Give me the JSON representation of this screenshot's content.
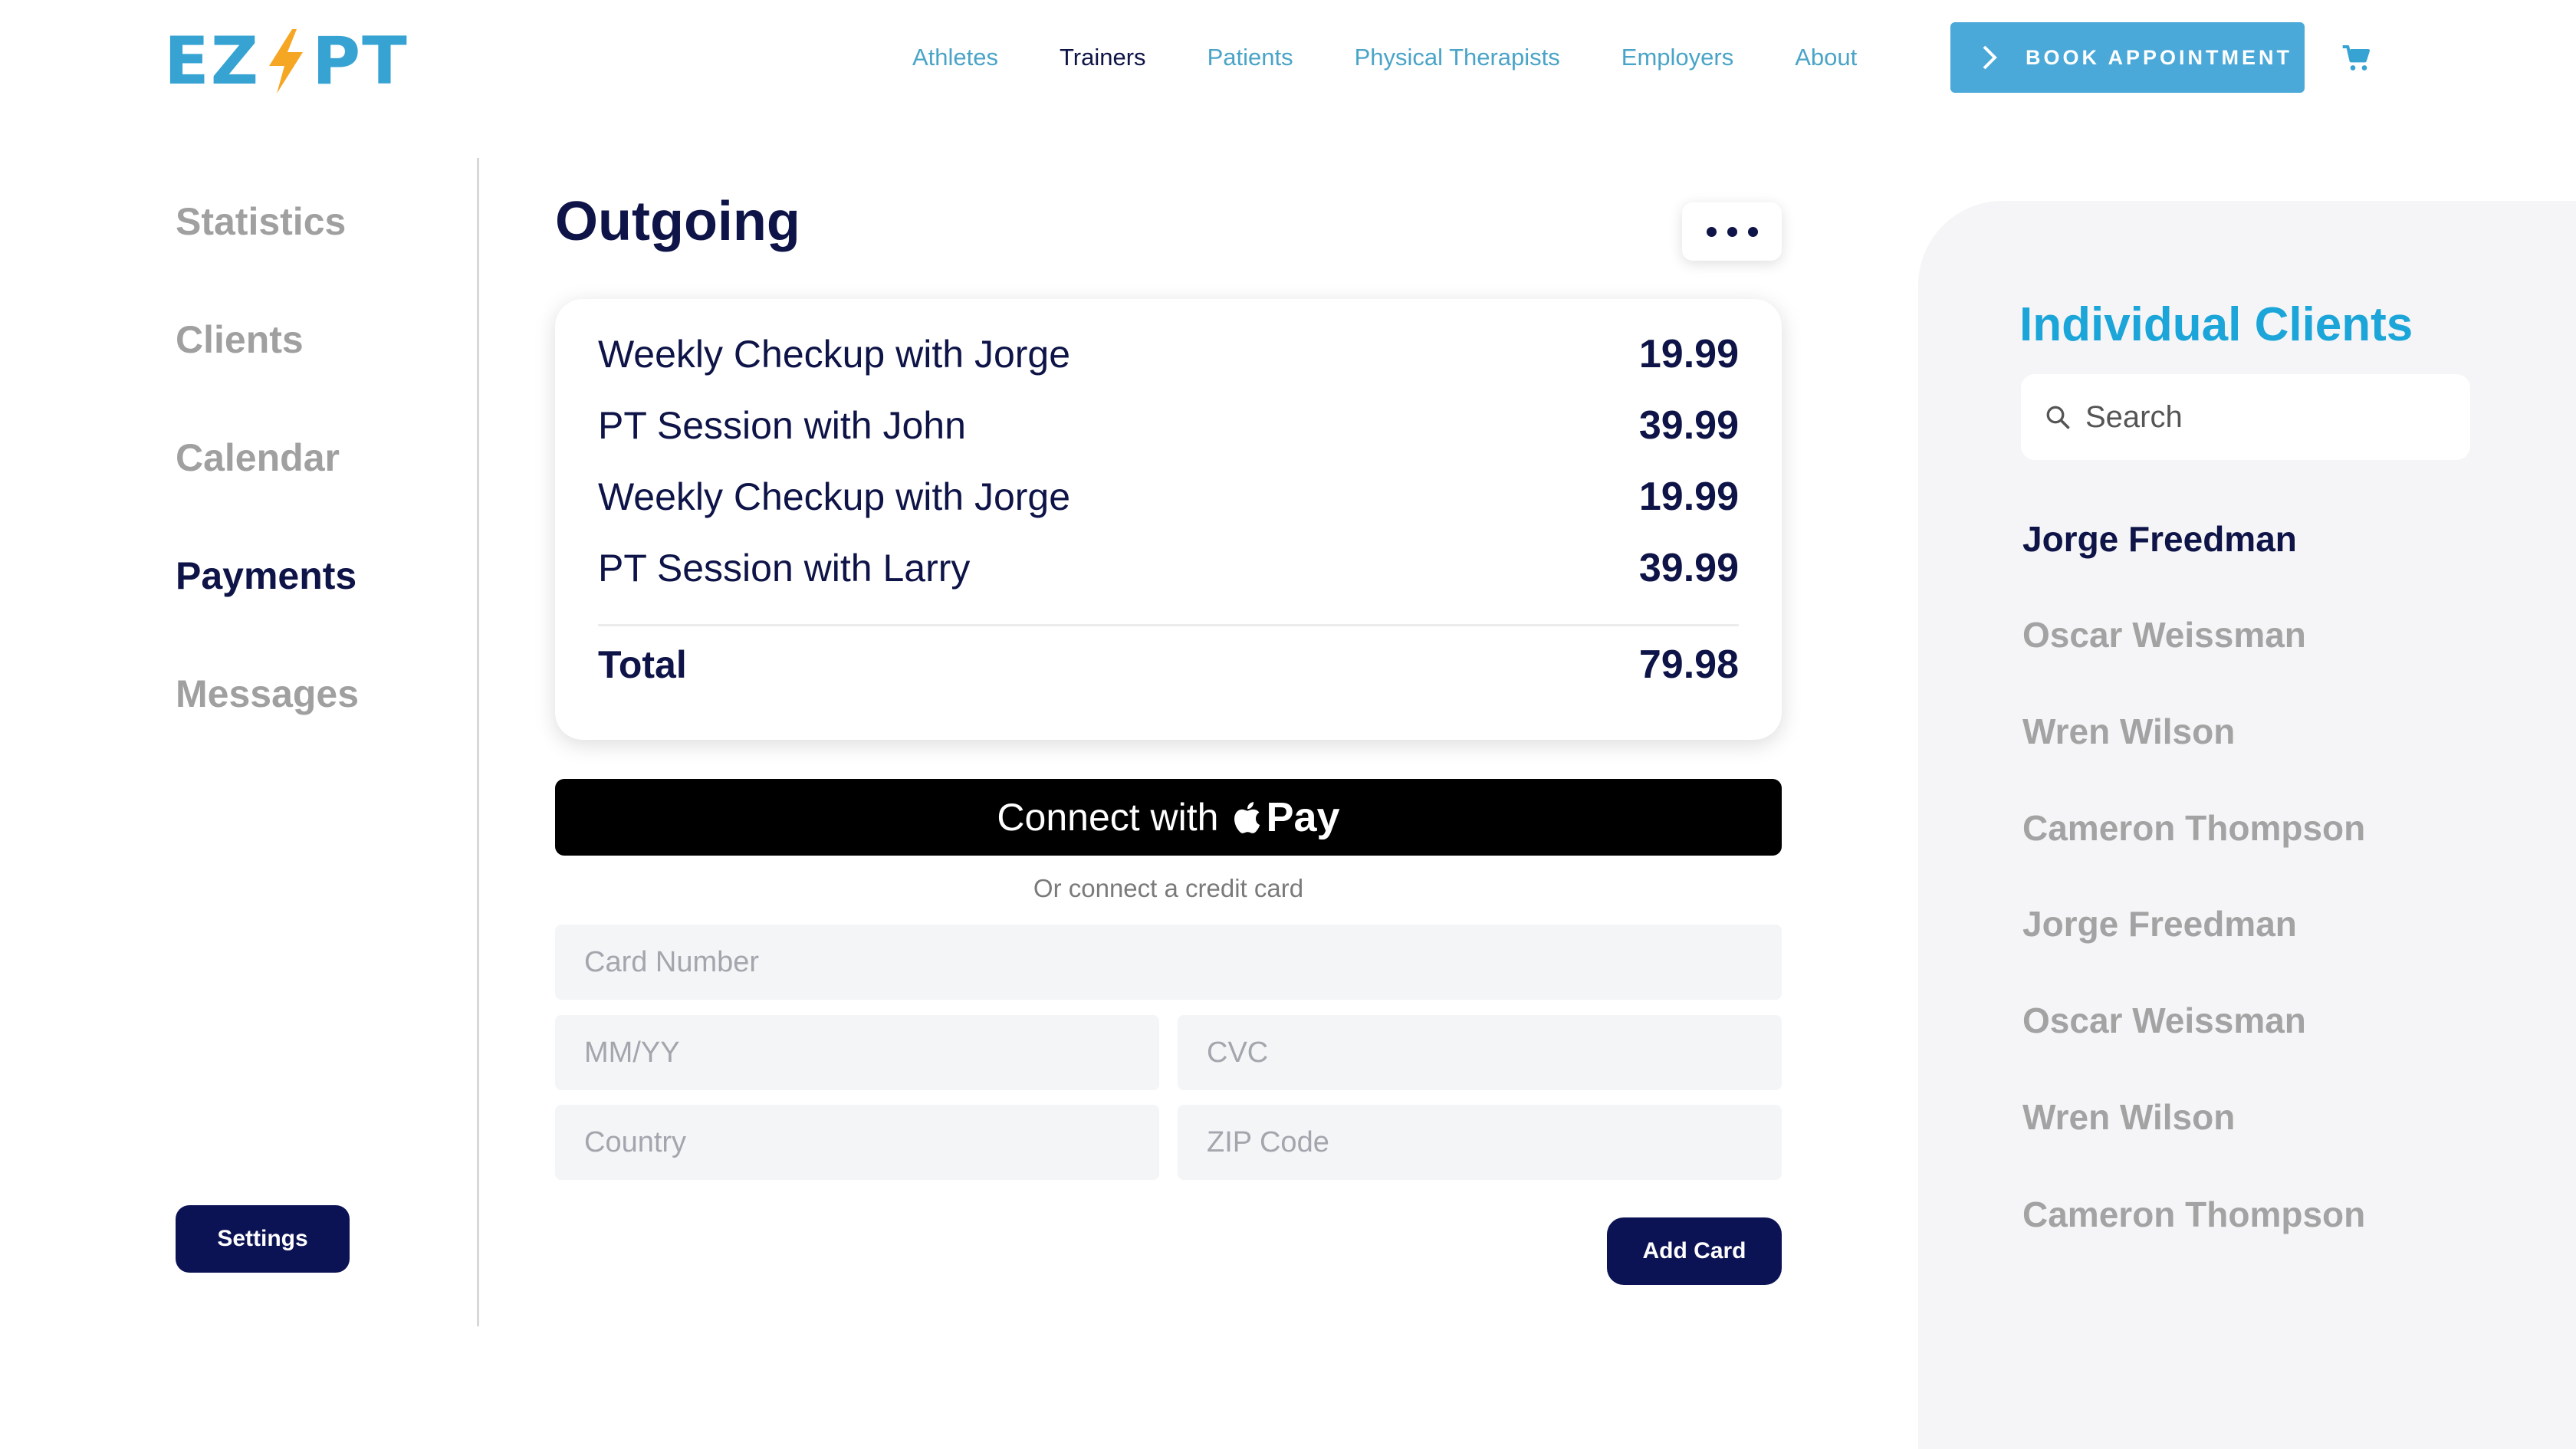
{
  "logo": {
    "left": "EZ",
    "right": "PT",
    "bolt_color": "#f5a623",
    "brand_color": "#36a3d3"
  },
  "nav": {
    "links": [
      "Athletes",
      "Trainers",
      "Patients",
      "Physical Therapists",
      "Employers",
      "About"
    ],
    "active": "Trainers",
    "book_label": "BOOK APPOINTMENT",
    "cart_icon": "cart-icon"
  },
  "sidebar": {
    "items": [
      "Statistics",
      "Clients",
      "Calendar",
      "Payments",
      "Messages"
    ],
    "active": "Payments",
    "settings_label": "Settings"
  },
  "main": {
    "title": "Outgoing",
    "more_icon": "more-dots-icon",
    "items": [
      {
        "label": "Weekly Checkup with Jorge",
        "amount": "19.99"
      },
      {
        "label": "PT Session with John",
        "amount": "39.99"
      },
      {
        "label": "Weekly Checkup with Jorge",
        "amount": "19.99"
      },
      {
        "label": "PT Session with Larry",
        "amount": "39.99"
      }
    ],
    "total_label": "Total",
    "total_amount": "79.98",
    "apple_pay": {
      "prefix": "Connect with",
      "pay": "Pay"
    },
    "or_text": "Or connect a credit card",
    "fields": {
      "card_number": "Card Number",
      "expiry": "MM/YY",
      "cvc": "CVC",
      "country": "Country",
      "zip": "ZIP Code"
    },
    "add_card_label": "Add Card"
  },
  "clients_panel": {
    "title": "Individual Clients",
    "search_placeholder": "Search",
    "clients": [
      "Jorge Freedman",
      "Oscar Weissman",
      "Wren Wilson",
      "Cameron Thompson",
      "Jorge Freedman",
      "Oscar Weissman",
      "Wren Wilson",
      "Cameron Thompson"
    ],
    "active_index": 0
  },
  "colors": {
    "navy": "#0e1447",
    "accent": "#4aa9d8",
    "muted": "#a3a3a3",
    "button_dark": "#0c1355"
  }
}
